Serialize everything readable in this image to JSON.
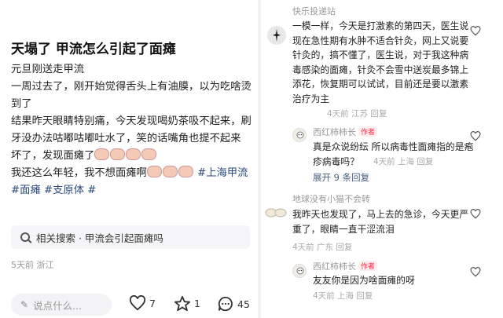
{
  "post": {
    "title": "天塌了 甲流怎么引起了面瘫",
    "lines": [
      "元旦刚送走甲流",
      "一周过去了，刚开始觉得舌头上有油膜，以为吃啥烫到了",
      "结果昨天眼睛特别痛，今天发现喝奶茶吸不起来，刷牙没办法咕嘟咕嘟吐水了，笑的话嘴角也提不起来",
      "坏了，发现面瘫了",
      "我还这么年轻，我不想面瘫啊"
    ],
    "tags": [
      "#上海甲流",
      "#面瘫",
      "#支原体",
      "#"
    ],
    "related_search": "相关搜索 · 甲流会引起面瘫吗",
    "meta": "5天前 浙江",
    "comment_placeholder": "说点什么...",
    "likes": "7",
    "favorites": "1",
    "comments": "45"
  },
  "comments": [
    {
      "user": "快乐投递站",
      "text": "一模一样，今天是打激素的第四天，医生说现在急性期有水肿不适合针灸，网上又说要针灸的，搞不懂了，医生说，对于我这种病毒感染的面瘫，针灸不会雪中送炭最多锦上添花，恢复期可以试试，目前还是要以激素治疗为主",
      "meta": "4天前 江苏 回复",
      "replies": [
        {
          "user": "西红柿柿长",
          "badge": "作者",
          "text": "真是众说纷纭 所以病毒性面瘫指的是疱疹病毒吗？",
          "meta": "4天前 上海 回复"
        }
      ],
      "expand": "展开 9 条回复"
    },
    {
      "user": "地球没有小猫不会转",
      "text": "我昨天也发现了，马上去的急诊，今天更严重了，眼睛一直干涩流泪",
      "meta": "4天前 广东 回复",
      "replies": [
        {
          "user": "西红柿柿长",
          "badge": "作者",
          "text": "友友你是因为啥面瘫的呀",
          "meta": "4天前 上海 回复"
        }
      ]
    }
  ]
}
